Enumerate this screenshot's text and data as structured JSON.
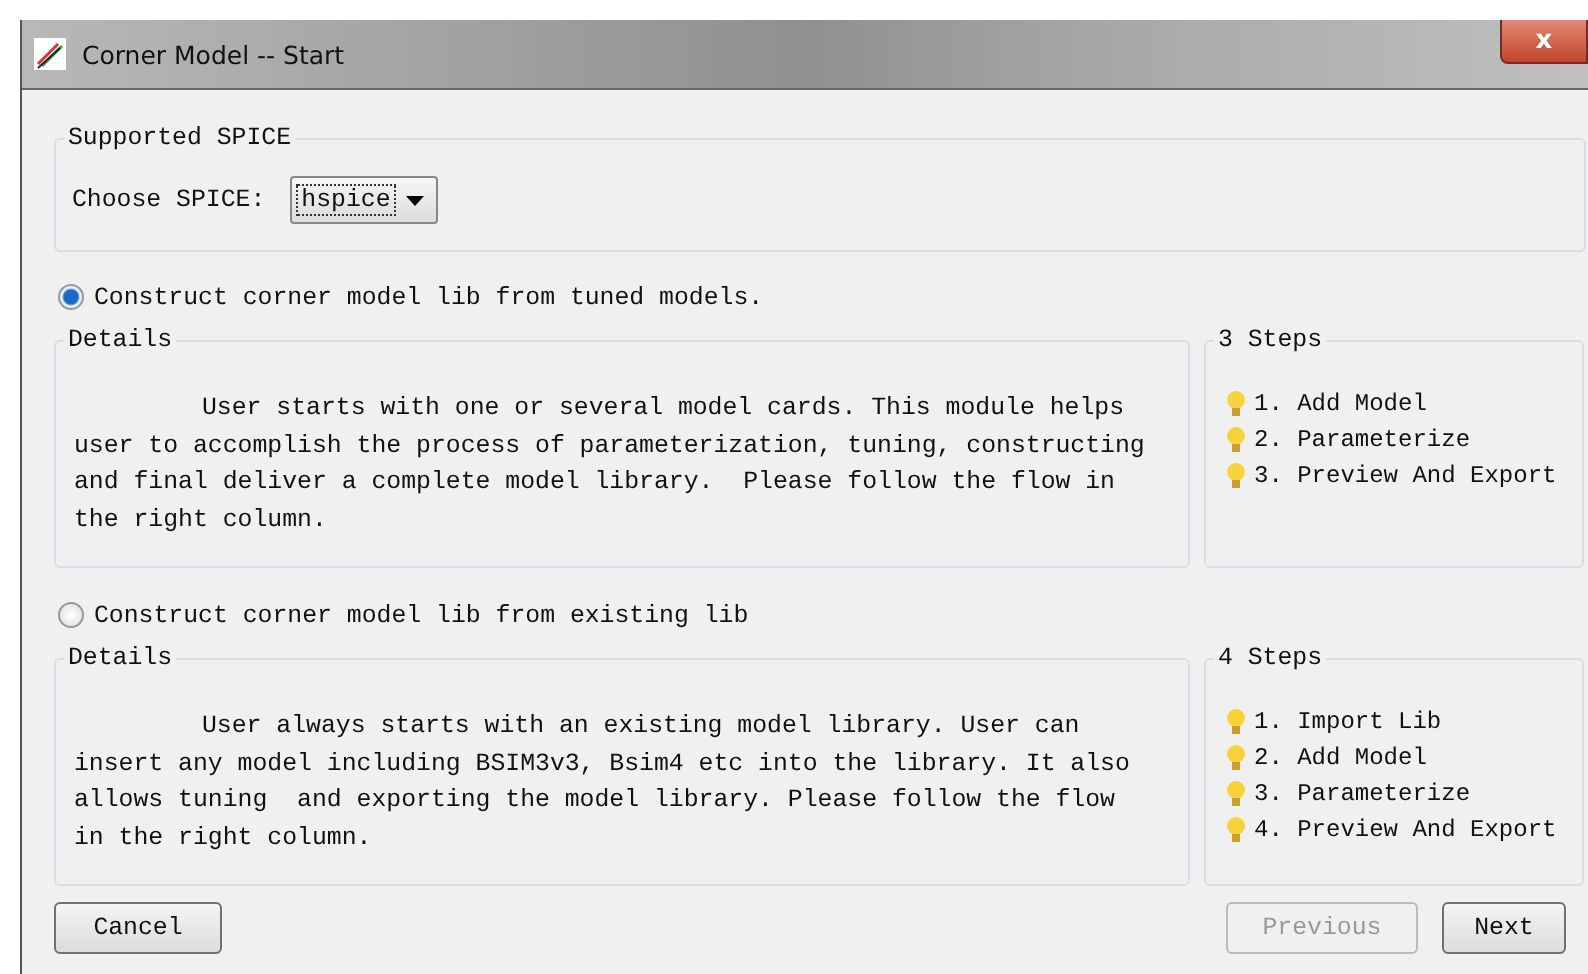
{
  "window": {
    "title": "Corner Model -- Start",
    "close": "x"
  },
  "spice": {
    "legend": "Supported SPICE",
    "label": "Choose SPICE:",
    "value": "hspice"
  },
  "options": [
    {
      "label": "Construct corner model lib from tuned models.",
      "selected": true,
      "details_legend": "Details",
      "details": "User starts with one or several model cards. This module helps user to accomplish the process of parameterization, tuning, constructing and final deliver a complete model library.  Please follow the flow in the right column.",
      "steps_legend": "3 Steps",
      "steps": [
        "1. Add Model",
        "2. Parameterize",
        "3. Preview And Export"
      ]
    },
    {
      "label": "Construct corner model lib from existing lib",
      "selected": false,
      "details_legend": "Details",
      "details": "User always starts with an existing model library. User can insert any model including BSIM3v3, Bsim4 etc into the library. It also allows tuning  and exporting the model library. Please follow the flow in the right column.",
      "steps_legend": "4 Steps",
      "steps": [
        "1. Import Lib",
        "2. Add Model",
        "3. Parameterize",
        "4. Preview And Export"
      ]
    }
  ],
  "cancel_button": {
    "label": "Cancel",
    "disabled": false
  },
  "nav_buttons": [
    {
      "label": "Previous",
      "disabled": true
    },
    {
      "label": "Next",
      "disabled": false
    }
  ]
}
